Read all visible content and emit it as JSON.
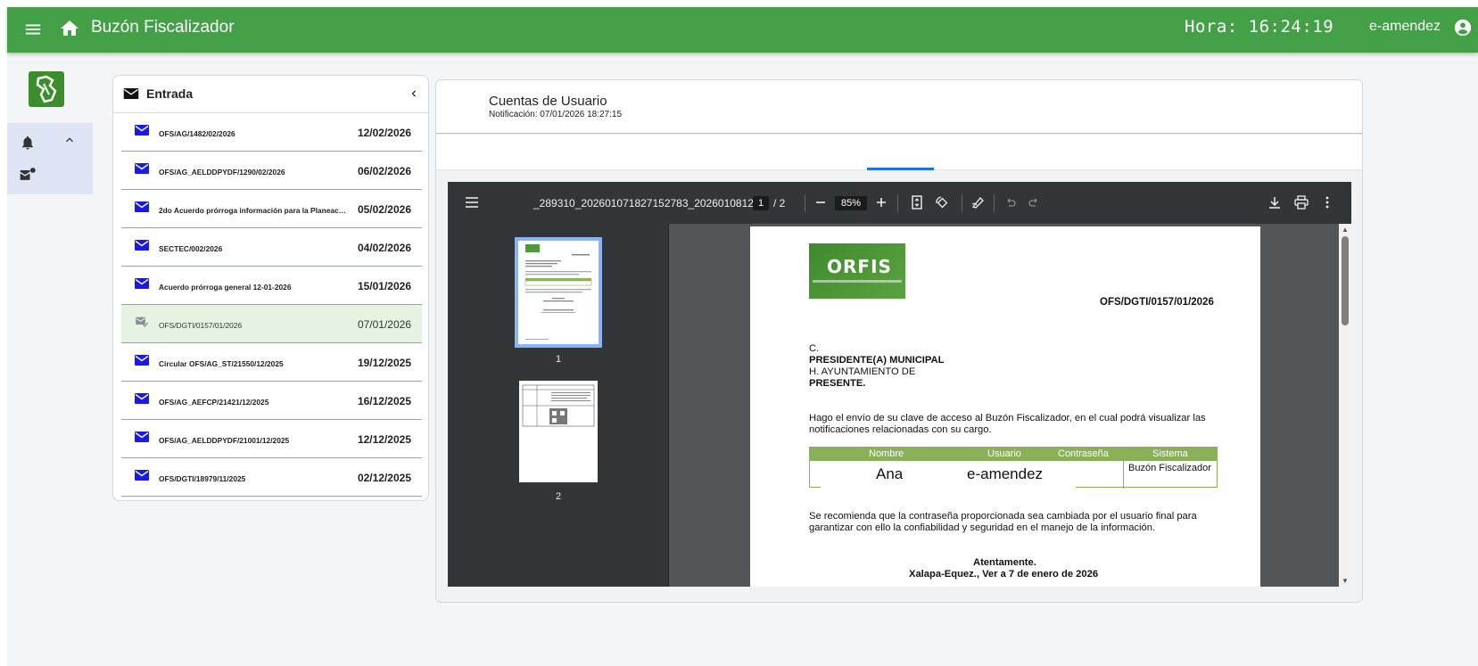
{
  "header": {
    "app_title": "Buzón Fiscalizador",
    "clock": "Hora: 16:24:19",
    "username": "e-amendez",
    "color": "#43a047"
  },
  "inbox": {
    "title": "Entrada",
    "messages": [
      {
        "subject": "OFS/AG/1482/02/2026",
        "date": "12/02/2026",
        "read": false
      },
      {
        "subject": "OFS/AG_AELDDPYDF/1290/02/2026",
        "date": "06/02/2026",
        "read": false
      },
      {
        "subject": "2do Acuerdo prórroga información para la Planeación...",
        "date": "05/02/2026",
        "read": false
      },
      {
        "subject": "SECTEC/002/2026",
        "date": "04/02/2026",
        "read": false
      },
      {
        "subject": "Acuerdo prórroga general 12-01-2026",
        "date": "15/01/2026",
        "read": false
      },
      {
        "subject": "OFS/DGTI/0157/01/2026",
        "date": "07/01/2026",
        "read": true
      },
      {
        "subject": "Circular OFS/AG_ST/21550/12/2025",
        "date": "19/12/2025",
        "read": false
      },
      {
        "subject": "OFS/AG_AEFCP/21421/12/2025",
        "date": "16/12/2025",
        "read": false
      },
      {
        "subject": "OFS/AG_AELDDPYDF/21001/12/2025",
        "date": "12/12/2025",
        "read": false
      },
      {
        "subject": "OFS/DGTI/18979/11/2025",
        "date": "02/12/2025",
        "read": false
      }
    ]
  },
  "detail": {
    "title": "Cuentas de Usuario",
    "subtitle": "Notificación: 07/01/2026 18:27:15"
  },
  "pdf": {
    "filename": "_289310_202601071827152783_2026010812...",
    "page_current": "1",
    "page_total": "/ 2",
    "zoom": "85%",
    "thumb_labels": [
      "1",
      "2"
    ],
    "document": {
      "logo_text": "ORFIS",
      "reference": "OFS/DGTI/0157/01/2026",
      "c_line": "C.",
      "recipient": "PRESIDENTE(A) MUNICIPAL",
      "ayuntamiento": "H. AYUNTAMIENTO DE",
      "presente": "PRESENTE.",
      "body1": "Hago el envío de su clave de acceso al Buzón Fiscalizador, en el cual podrá visualizar las notificaciones relacionadas con su cargo.",
      "table_headers": [
        "Nombre",
        "Usuario",
        "Contraseña",
        "Sistema"
      ],
      "row_nombre": "Ana",
      "row_usuario": "e-amendez",
      "row_sistema": "Buzón Fiscalizador",
      "body2": "Se recomienda que la contraseña proporcionada sea cambiada por el usuario final para garantizar con ello la confiabilidad y seguridad en el manejo de la información.",
      "closing": "Atentamente.",
      "place_date": "Xalapa-Equez., Ver a 7 de enero de 2026"
    }
  }
}
